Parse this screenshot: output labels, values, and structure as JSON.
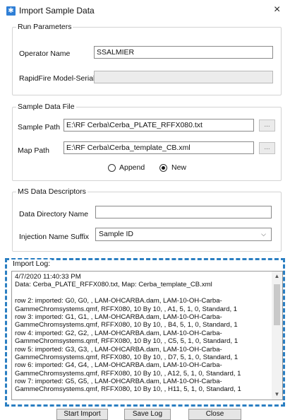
{
  "window": {
    "title": "Import Sample Data",
    "close_glyph": "×",
    "icon": "app-icon"
  },
  "run_parameters": {
    "title": "Run Parameters",
    "operator_label": "Operator Name",
    "operator_value": "SSALMIER",
    "model_label": "RapidFire Model-Serial",
    "model_value": ""
  },
  "sample_data_file": {
    "title": "Sample Data File",
    "sample_path_label": "Sample Path",
    "sample_path_value": "E:\\RF Cerba\\Cerba_PLATE_RFFX080.txt",
    "map_path_label": "Map Path",
    "map_path_value": "E:\\RF Cerba\\Cerba_template_CB.xml",
    "browse_label": "...",
    "append_label": "Append",
    "new_label": "New",
    "selected_mode": "New"
  },
  "ms_data_descriptors": {
    "title": "MS Data Descriptors",
    "data_dir_label": "Data Directory Name",
    "data_dir_value": "",
    "injection_suffix_label": "Injection Name Suffix",
    "injection_suffix_value": "Sample ID"
  },
  "import_log": {
    "title": "Import Log:",
    "lines": [
      "4/7/2020 11:40:33 PM",
      "Data: Cerba_PLATE_RFFX080.txt, Map: Cerba_template_CB.xml",
      "",
      "row 2: imported: G0, G0, , LAM-OHCARBA.dam, LAM-10-OH-Carba-",
      "GammeChromsystems.qmf, RFFX080, 10 By 10, , A1, 5, 1, 0, Standard, 1",
      "row 3: imported: G1, G1, , LAM-OHCARBA.dam, LAM-10-OH-Carba-",
      "GammeChromsystems.qmf, RFFX080, 10 By 10, , B4, 5, 1, 0, Standard, 1",
      "row 4: imported: G2, G2, , LAM-OHCARBA.dam, LAM-10-OH-Carba-",
      "GammeChromsystems.qmf, RFFX080, 10 By 10, , C5, 5, 1, 0, Standard, 1",
      "row 5: imported: G3, G3, , LAM-OHCARBA.dam, LAM-10-OH-Carba-",
      "GammeChromsystems.qmf, RFFX080, 10 By 10, , D7, 5, 1, 0, Standard, 1",
      "row 6: imported: G4, G4, , LAM-OHCARBA.dam, LAM-10-OH-Carba-",
      "GammeChromsystems.qmf, RFFX080, 10 By 10, , A12, 5, 1, 0, Standard, 1",
      "row 7: imported: G5, G5, , LAM-OHCARBA.dam, LAM-10-OH-Carba-",
      "GammeChromsystems.qmf, RFFX080, 10 By 10, , H11, 5, 1, 0, Standard, 1"
    ]
  },
  "buttons": {
    "start_import": "Start Import",
    "save_log": "Save Log",
    "close": "Close"
  },
  "colors": {
    "accent_dashed": "#2b7fc2",
    "app_icon": "#2f7fd6"
  }
}
